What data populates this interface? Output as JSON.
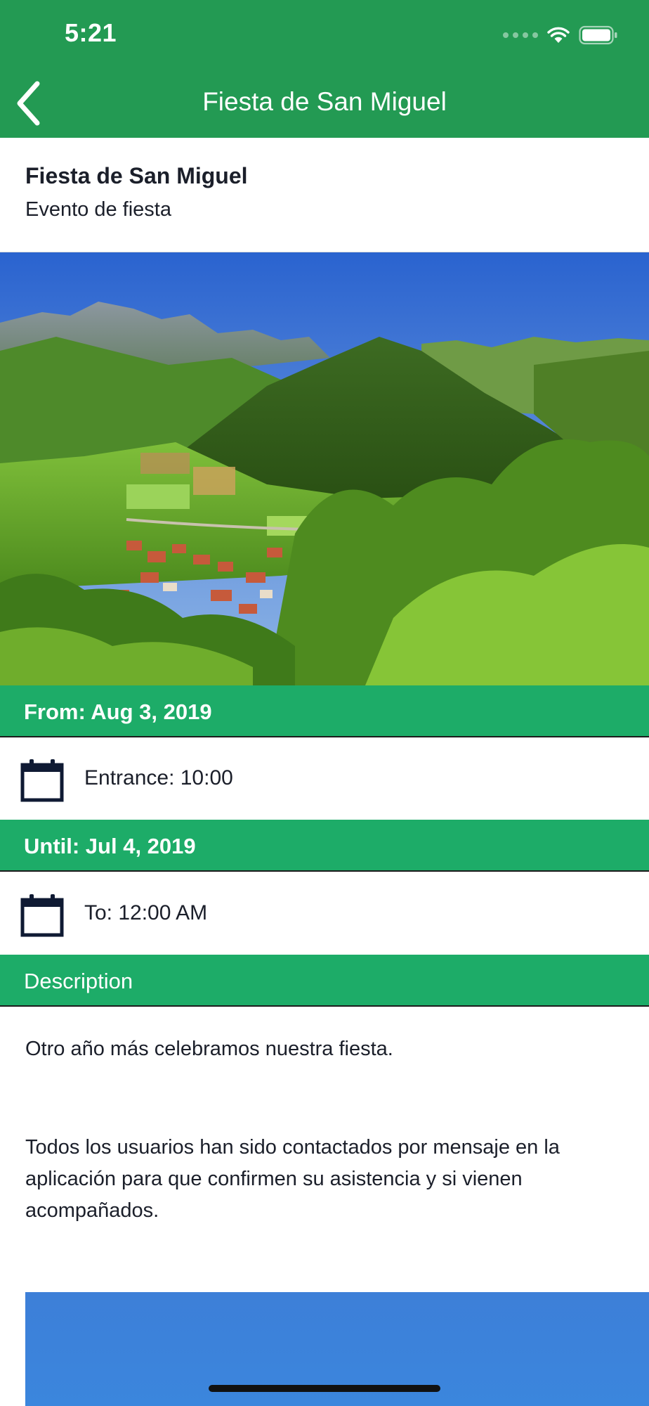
{
  "status_bar": {
    "time": "5:21"
  },
  "nav": {
    "title": "Fiesta de San Miguel",
    "back_icon": "chevron-left-icon"
  },
  "event": {
    "name": "Fiesta de San Miguel",
    "type": "Evento de fiesta"
  },
  "from_section": {
    "header": "From: Aug 3, 2019",
    "row_icon": "calendar-icon",
    "row_text": "Entrance: 10:00"
  },
  "until_section": {
    "header": "Until: Jul 4, 2019",
    "row_icon": "calendar-icon",
    "row_text": "To: 12:00 AM"
  },
  "description": {
    "header": "Description",
    "paragraph_1": "Otro año más celebramos nuestra fiesta.",
    "paragraph_2": "Todos los usuarios han sido contactados por mensaje en la aplicación para que confirmen su asistencia y si vienen acompañados."
  },
  "colors": {
    "nav_green": "#239a53",
    "section_green": "#1dac68",
    "text_dark": "#1b1f2a"
  }
}
